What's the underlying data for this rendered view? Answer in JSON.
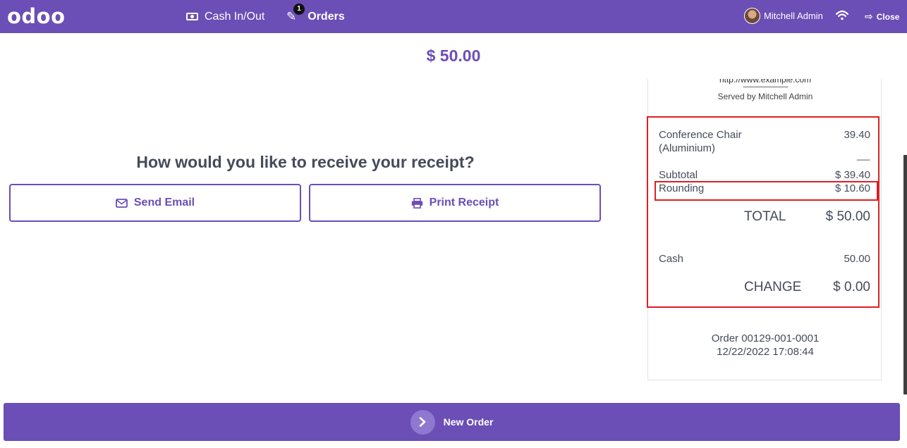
{
  "header": {
    "logo": "odoo",
    "cash_in_out": "Cash In/Out",
    "orders_label": "Orders",
    "orders_badge": "1",
    "user_name": "Mitchell Admin",
    "close_label": "Close"
  },
  "payment": {
    "amount": "$ 50.00",
    "question": "How would you like to receive your receipt?",
    "send_email": "Send Email",
    "print_receipt": "Print Receipt"
  },
  "receipt": {
    "url": "http://www.example.com",
    "separator": "--------------------------------",
    "served_by": "Served by Mitchell Admin",
    "line_item_name_1": "Conference Chair",
    "line_item_name_2": "(Aluminium)",
    "line_item_price": "39.40",
    "subtotal_dash": "--------",
    "subtotal_label": "Subtotal",
    "subtotal_value": "$ 39.40",
    "rounding_label": "Rounding",
    "rounding_value": "$ 10.60",
    "total_dash": "--------",
    "total_label": "TOTAL",
    "total_value": "$ 50.00",
    "cash_label": "Cash",
    "cash_value": "50.00",
    "change_label": "CHANGE",
    "change_value": "$ 0.00",
    "order_ref": "Order 00129-001-0001",
    "order_datetime": "12/22/2022 17:08:44"
  },
  "footer": {
    "new_order": "New Order"
  },
  "colors": {
    "brand": "#6b4eb6",
    "highlight": "#dd1f26"
  }
}
